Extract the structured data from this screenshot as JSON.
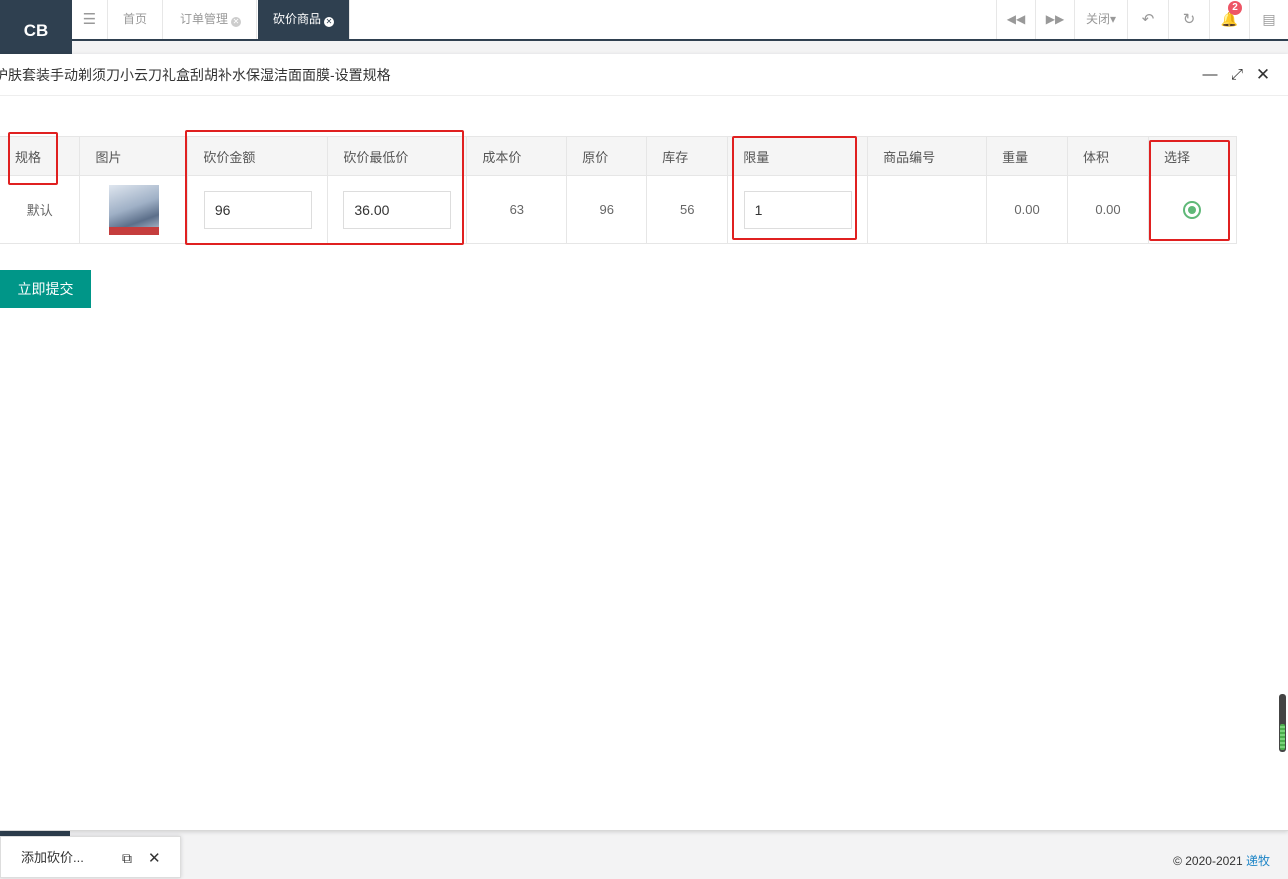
{
  "app": {
    "logo": "CB"
  },
  "header": {
    "tabs": [
      {
        "label": "首页"
      },
      {
        "label": "订单管理"
      },
      {
        "label": "砍价商品"
      }
    ],
    "close_label": "关闭",
    "notification_count": "2"
  },
  "dialog": {
    "title": "护肤套装手动剃须刀小云刀礼盒刮胡补水保湿洁面面膜-设置规格",
    "columns": [
      "规格",
      "图片",
      "砍价金额",
      "砍价最低价",
      "成本价",
      "原价",
      "库存",
      "限量",
      "商品编号",
      "重量",
      "体积",
      "选择"
    ],
    "row": {
      "spec": "默认",
      "bargain_amount": "96",
      "min_price": "36.00",
      "cost_price": "63",
      "original_price": "96",
      "stock": "56",
      "limit": "1",
      "product_code": "",
      "weight": "0.00",
      "volume": "0.00",
      "selected": true
    },
    "submit_label": "立即提交"
  },
  "minimized_window": {
    "label": "添加砍价..."
  },
  "footer": {
    "copyright": "© 2020-2021",
    "link_text": "递牧"
  },
  "colors": {
    "accent": "#009688",
    "sidebar": "#2f4050",
    "highlight": "#e02020",
    "radio": "#5fb878"
  }
}
